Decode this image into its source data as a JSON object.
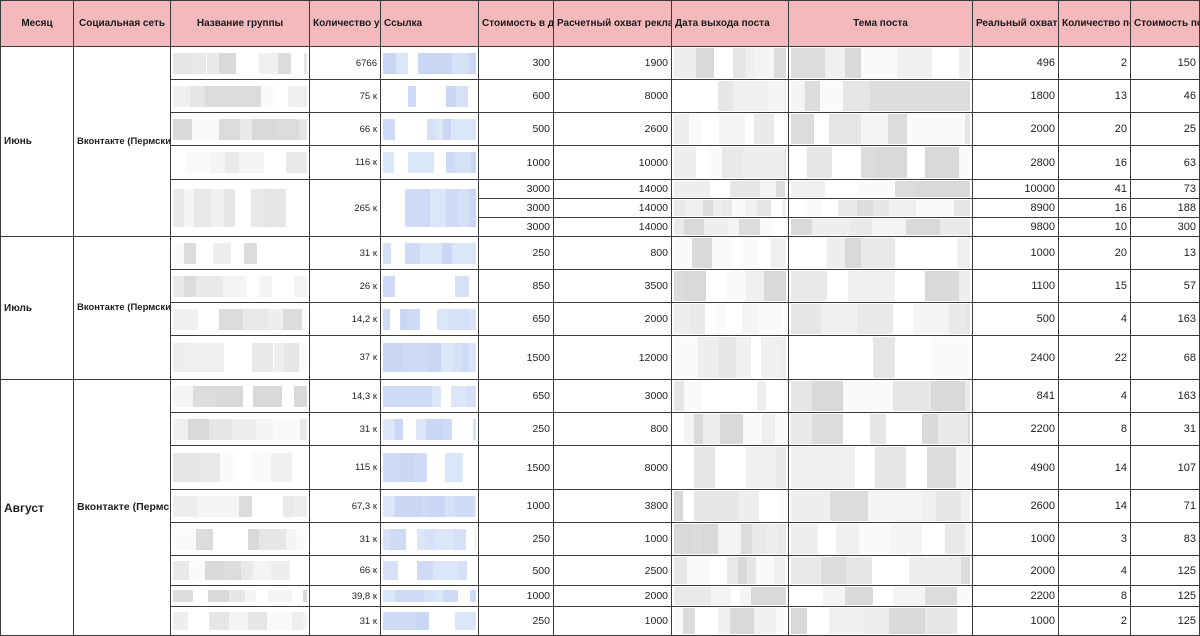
{
  "headers": {
    "month": "Месяц",
    "network": "Социальная сеть",
    "group": "Название группы",
    "members": "Количество участников",
    "link": "Ссылка",
    "cost": "Стоимость в день (р)",
    "est_reach": "Расчетный охват рекламы в день (человек)",
    "post_date": "Дата выхода поста",
    "topic": "Тема поста",
    "real_reach": "Реальный охват рекламы (человек)",
    "subs": "Количество подписок",
    "sub_cost": "Стоимость подписки (р)"
  },
  "sections": [
    {
      "month": "Июнь",
      "network": "Вконтакте (Пермский край)",
      "rows": [
        {
          "members": "6766",
          "cost": "300",
          "est_reach": "1900",
          "real_reach": "496",
          "subs": "2",
          "sub_cost": "150"
        },
        {
          "members": "75 к",
          "cost": "600",
          "est_reach": "8000",
          "real_reach": "1800",
          "subs": "13",
          "sub_cost": "46"
        },
        {
          "members": "66 к",
          "cost": "500",
          "est_reach": "2600",
          "real_reach": "2000",
          "subs": "20",
          "sub_cost": "25"
        },
        {
          "members": "116 к",
          "cost": "1000",
          "est_reach": "10000",
          "real_reach": "2800",
          "subs": "16",
          "sub_cost": "63"
        },
        {
          "members": "265 к",
          "cost": "3000",
          "est_reach": "14000",
          "real_reach": "10000",
          "subs": "41",
          "sub_cost": "73"
        },
        {
          "members": "",
          "cost": "3000",
          "est_reach": "14000",
          "real_reach": "8900",
          "subs": "16",
          "sub_cost": "188"
        },
        {
          "members": "",
          "cost": "3000",
          "est_reach": "14000",
          "real_reach": "9800",
          "subs": "10",
          "sub_cost": "300"
        }
      ]
    },
    {
      "month": "Июль",
      "network": "Вконтакте (Пермский край)",
      "rows": [
        {
          "members": "31 к",
          "cost": "250",
          "est_reach": "800",
          "real_reach": "1000",
          "subs": "20",
          "sub_cost": "13"
        },
        {
          "members": "26 к",
          "cost": "850",
          "est_reach": "3500",
          "real_reach": "1100",
          "subs": "15",
          "sub_cost": "57"
        },
        {
          "members": "14,2 к",
          "cost": "650",
          "est_reach": "2000",
          "real_reach": "500",
          "subs": "4",
          "sub_cost": "163"
        },
        {
          "members": "37 к",
          "cost": "1500",
          "est_reach": "12000",
          "real_reach": "2400",
          "subs": "22",
          "sub_cost": "68"
        }
      ]
    },
    {
      "month": "Август",
      "network": "Вконтакте (Пермский край)",
      "rows": [
        {
          "members": "14,3 к",
          "cost": "650",
          "est_reach": "3000",
          "real_reach": "841",
          "subs": "4",
          "sub_cost": "163"
        },
        {
          "members": "31 к",
          "cost": "250",
          "est_reach": "800",
          "real_reach": "2200",
          "subs": "8",
          "sub_cost": "31"
        },
        {
          "members": "115 к",
          "cost": "1500",
          "est_reach": "8000",
          "real_reach": "4900",
          "subs": "14",
          "sub_cost": "107"
        },
        {
          "members": "67,3 к",
          "cost": "1000",
          "est_reach": "3800",
          "real_reach": "2600",
          "subs": "14",
          "sub_cost": "71"
        },
        {
          "members": "31 к",
          "cost": "250",
          "est_reach": "1000",
          "real_reach": "1000",
          "subs": "3",
          "sub_cost": "83"
        },
        {
          "members": "66 к",
          "cost": "500",
          "est_reach": "2500",
          "real_reach": "2000",
          "subs": "4",
          "sub_cost": "125"
        },
        {
          "members": "39,8 к",
          "cost": "1000",
          "est_reach": "2000",
          "real_reach": "2200",
          "subs": "8",
          "sub_cost": "125"
        },
        {
          "members": "31 к",
          "cost": "250",
          "est_reach": "1000",
          "real_reach": "1000",
          "subs": "2",
          "sub_cost": "125"
        }
      ]
    }
  ]
}
